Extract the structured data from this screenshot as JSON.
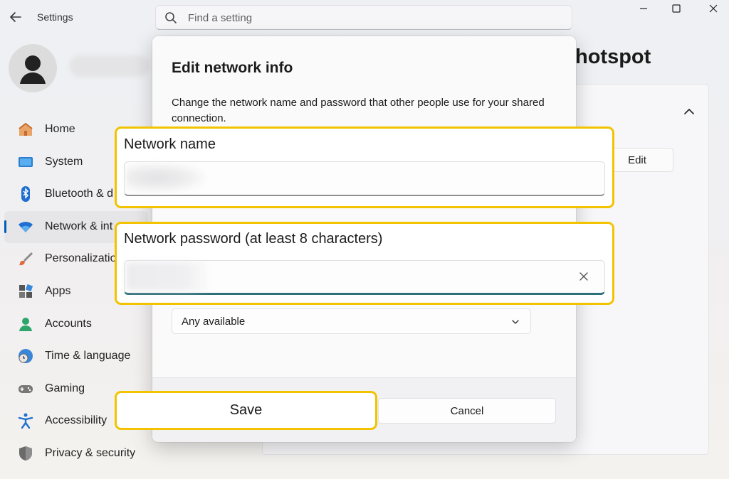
{
  "app": {
    "title": "Settings"
  },
  "search": {
    "placeholder": "Find a setting"
  },
  "nav": {
    "items": [
      {
        "label": "Home",
        "icon": "home-icon"
      },
      {
        "label": "System",
        "icon": "system-icon"
      },
      {
        "label": "Bluetooth & d",
        "icon": "bluetooth-icon"
      },
      {
        "label": "Network & int",
        "icon": "network-icon",
        "selected": true
      },
      {
        "label": "Personalizatio",
        "icon": "brush-icon"
      },
      {
        "label": "Apps",
        "icon": "apps-icon"
      },
      {
        "label": "Accounts",
        "icon": "accounts-icon"
      },
      {
        "label": "Time & language",
        "icon": "time-language-icon"
      },
      {
        "label": "Gaming",
        "icon": "gamepad-icon"
      },
      {
        "label": "Accessibility",
        "icon": "accessibility-icon"
      },
      {
        "label": "Privacy & security",
        "icon": "shield-icon"
      }
    ]
  },
  "page": {
    "title_visible": "hotspot",
    "edit_label": "Edit"
  },
  "dialog": {
    "title": "Edit network info",
    "description": "Change the network name and password that other people use for your shared connection.",
    "network_name_label": "Network name",
    "network_password_label": "Network password (at least 8 characters)",
    "band_value": "Any available",
    "save_label": "Save",
    "cancel_label": "Cancel"
  },
  "colors": {
    "highlight": "#f3c300",
    "accent": "#005fb8",
    "password_underline": "#2e6f78"
  }
}
